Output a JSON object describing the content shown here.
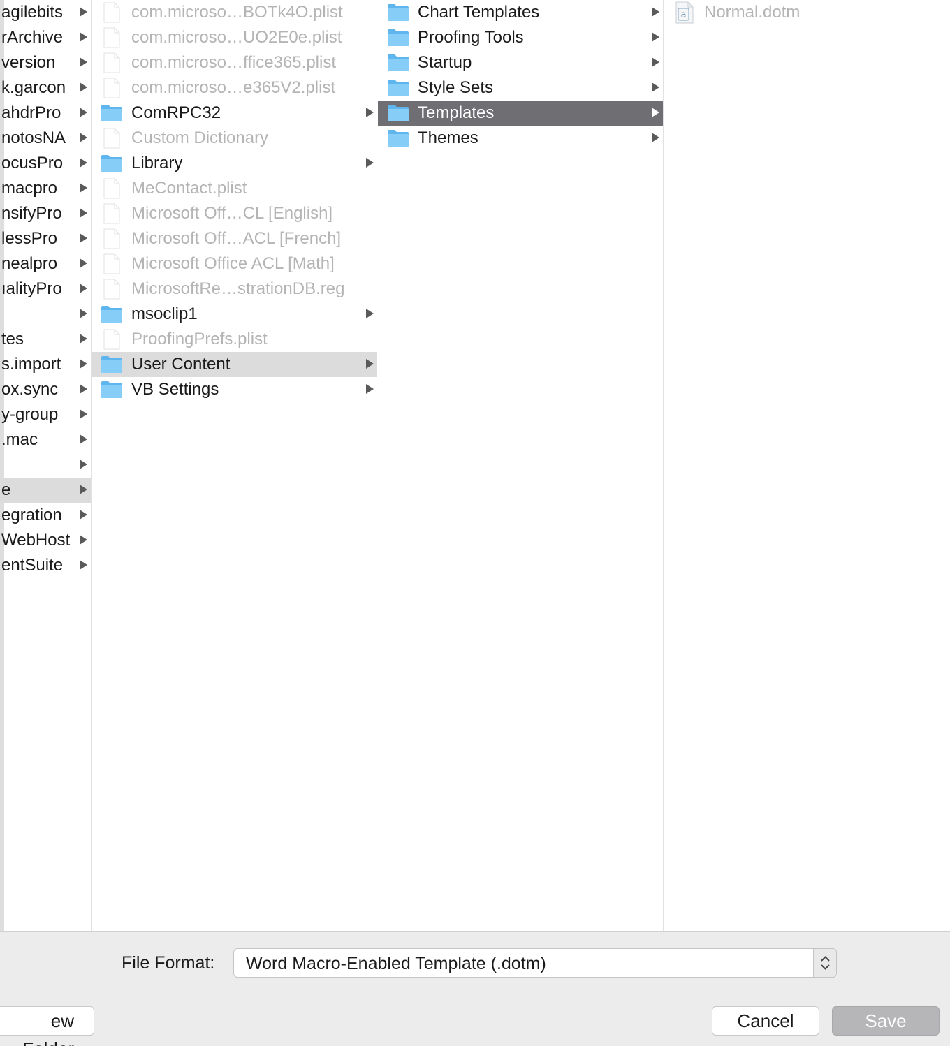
{
  "column1": {
    "rows": [
      {
        "label": "agilebits"
      },
      {
        "label": "rArchive"
      },
      {
        "label": "version"
      },
      {
        "label": "k.garcon"
      },
      {
        "label": "ahdrPro"
      },
      {
        "label": "notosNA"
      },
      {
        "label": "ocusPro"
      },
      {
        "label": "macpro"
      },
      {
        "label": "nsifyPro"
      },
      {
        "label": "lessPro"
      },
      {
        "label": "nealpro"
      },
      {
        "label": "ıalityPro"
      },
      {
        "label": ""
      },
      {
        "label": "tes"
      },
      {
        "label": "s.import"
      },
      {
        "label": "ox.sync"
      },
      {
        "label": "y-group"
      },
      {
        "label": ".mac"
      },
      {
        "label": ""
      },
      {
        "label": "e"
      },
      {
        "label": "egration"
      },
      {
        "label": "WebHost"
      },
      {
        "label": "entSuite"
      }
    ]
  },
  "column2": {
    "rows": [
      {
        "label": "com.microso…BOTk4O.plist",
        "type": "file"
      },
      {
        "label": "com.microso…UO2E0e.plist",
        "type": "file"
      },
      {
        "label": "com.microso…ffice365.plist",
        "type": "file"
      },
      {
        "label": "com.microso…e365V2.plist",
        "type": "file"
      },
      {
        "label": "ComRPC32",
        "type": "folder"
      },
      {
        "label": "Custom Dictionary",
        "type": "file"
      },
      {
        "label": "Library",
        "type": "folder"
      },
      {
        "label": "MeContact.plist",
        "type": "file"
      },
      {
        "label": "Microsoft Off…CL [English]",
        "type": "file"
      },
      {
        "label": "Microsoft Off…ACL [French]",
        "type": "file"
      },
      {
        "label": "Microsoft Office ACL [Math]",
        "type": "file"
      },
      {
        "label": "MicrosoftRe…strationDB.reg",
        "type": "file"
      },
      {
        "label": "msoclip1",
        "type": "folder"
      },
      {
        "label": "ProofingPrefs.plist",
        "type": "file"
      },
      {
        "label": "User Content",
        "type": "folder"
      },
      {
        "label": "VB Settings",
        "type": "folder"
      }
    ]
  },
  "column3": {
    "rows": [
      {
        "label": "Chart Templates"
      },
      {
        "label": "Proofing Tools"
      },
      {
        "label": "Startup"
      },
      {
        "label": "Style Sets"
      },
      {
        "label": "Templates"
      },
      {
        "label": "Themes"
      }
    ]
  },
  "column4": {
    "rows": [
      {
        "label": "Normal.dotm",
        "icon": "word-template-icon"
      }
    ]
  },
  "footer": {
    "file_format_label": "File Format:",
    "file_format_value": "Word Macro-Enabled Template (.dotm)",
    "new_folder_label": "ew Folder",
    "cancel_label": "Cancel",
    "save_label": "Save"
  },
  "colors": {
    "selected_active": "#6f6e72",
    "selected_inactive": "#dcdcdc",
    "folder_blue": "#75c3f5",
    "disabled_text": "#b4b4b4",
    "save_button": "#b6b6b8"
  }
}
